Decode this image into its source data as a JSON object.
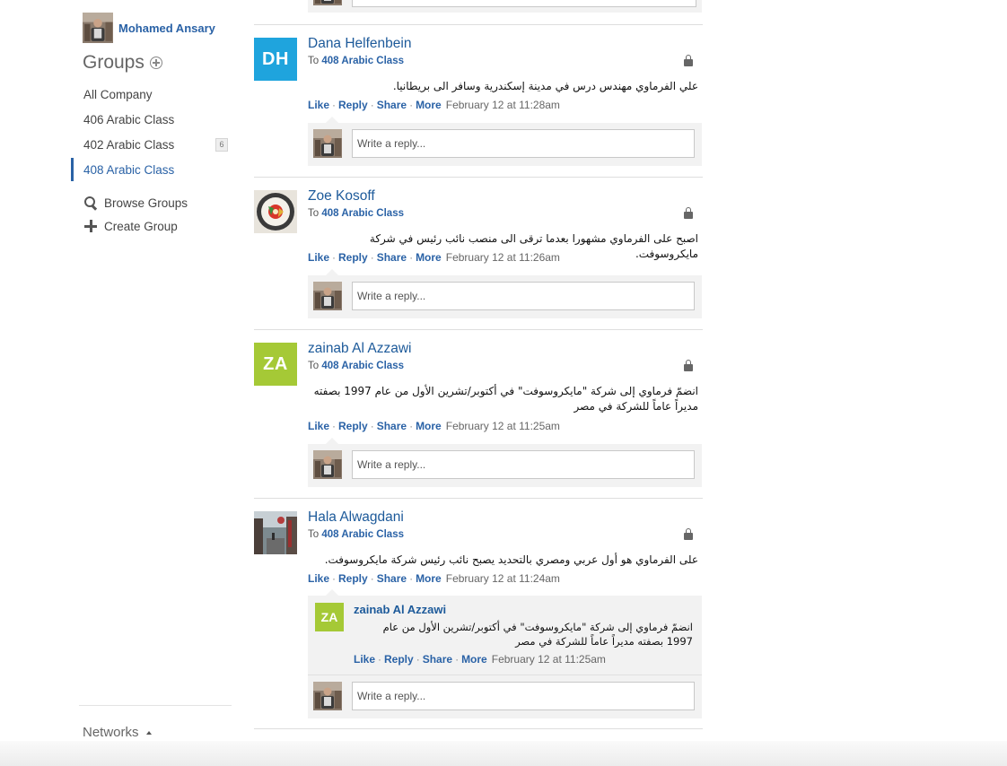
{
  "user": {
    "name": "Mohamed Ansary"
  },
  "sidebar": {
    "groups_title": "Groups",
    "groups": [
      {
        "label": "All Company"
      },
      {
        "label": "406 Arabic Class"
      },
      {
        "label": "402 Arabic Class",
        "badge": "6"
      },
      {
        "label": "408 Arabic Class",
        "active": true
      }
    ],
    "browse_groups": "Browse Groups",
    "create_group": "Create Group",
    "networks": "Networks"
  },
  "feed": {
    "to_label": "To",
    "reply_placeholder": "Write a reply...",
    "action_labels": {
      "like": "Like",
      "reply": "Reply",
      "share": "Share",
      "more": "More"
    },
    "posts": [
      {
        "author": "Dana Helfenbein",
        "initials": "DH",
        "avatar_color": "#1fa4dd",
        "group": "408 Arabic Class",
        "body": "علي الفرماوي مهندس درس في مدينة إسكندرية وسافر الى بريطانيا.",
        "time": "February 12 at 11:28am"
      },
      {
        "author": "Zoe Kosoff",
        "group": "408 Arabic Class",
        "body": "اصبح على الفرماوي مشهورا بعدما ترقى الى منصب نائب رئيس في شركة مايكروسوفت.",
        "time": "February 12 at 11:26am"
      },
      {
        "author": "zainab Al Azzawi",
        "initials": "ZA",
        "avatar_color": "#a5c936",
        "group": "408 Arabic Class",
        "body": "انضمّ فرماوي إلى شركة \"مايكروسوفت\" في أكتوبر/تشرين الأول من عام 1997 بصفته مديراً عاماً للشركة في مصر",
        "time": "February 12 at 11:25am"
      },
      {
        "author": "Hala Alwagdani",
        "group": "408 Arabic Class",
        "body": "على الفرماوي هو أول عربي ومصري بالتحديد يصبح نائب رئيس شركة مايكروسوفت.",
        "time": "February 12 at 11:24am",
        "reply": {
          "author": "zainab Al Azzawi",
          "initials": "ZA",
          "body": "انضمّ فرماوي إلى شركة \"مايكروسوفت\" في أكتوبر/تشرين الأول من عام 1997 بصفته مديراً عاماً للشركة في مصر",
          "time": "February 12 at 11:25am"
        }
      }
    ]
  }
}
